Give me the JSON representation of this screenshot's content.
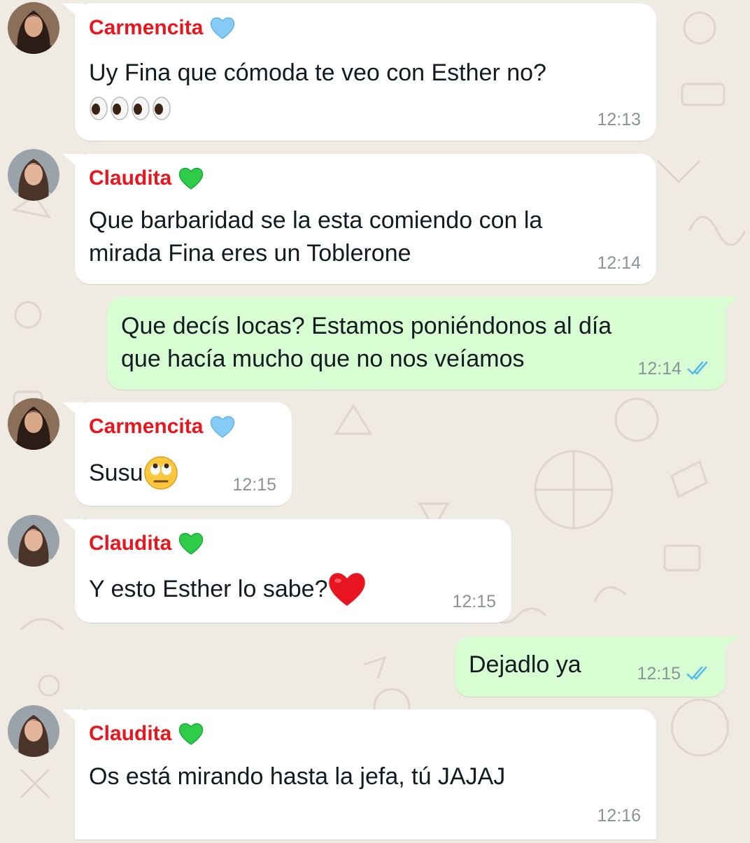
{
  "colors": {
    "background": "#efeae2",
    "incoming_bubble": "#ffffff",
    "outgoing_bubble": "#d9fdd3",
    "sender_name": "#e8171d",
    "read_ticks": "#53bdeb",
    "timestamp": "#8a9399"
  },
  "messages": [
    {
      "direction": "in",
      "sender": "Carmencita",
      "heart": "blue-heart-icon",
      "lines": [
        "Uy Fina que cómoda te veo con Esther no?"
      ],
      "emoji": "eyes-emoji x4",
      "time": "12:13"
    },
    {
      "direction": "in",
      "sender": "Claudita",
      "heart": "green-heart-icon",
      "lines": [
        "Que barbaridad se la esta comiendo con la",
        "mirada Fina eres un Toblerone"
      ],
      "time": "12:14"
    },
    {
      "direction": "out",
      "lines": [
        "Que decís locas? Estamos poniéndonos al día",
        "que hacía mucho que no nos veíamos"
      ],
      "time": "12:14",
      "status": "read"
    },
    {
      "direction": "in",
      "sender": "Carmencita",
      "heart": "blue-heart-icon",
      "lines": [
        "Susu"
      ],
      "emoji": "eye-roll-emoji",
      "time": "12:15"
    },
    {
      "direction": "in",
      "sender": "Claudita",
      "heart": "green-heart-icon",
      "lines": [
        "Y esto Esther lo sabe?"
      ],
      "emoji": "red-heart-emoji",
      "time": "12:15"
    },
    {
      "direction": "out",
      "lines": [
        "Dejadlo ya"
      ],
      "time": "12:15",
      "status": "read"
    },
    {
      "direction": "in",
      "sender": "Claudita",
      "heart": "green-heart-icon",
      "lines": [
        "Os está mirando hasta la jefa, tú JAJAJ"
      ],
      "time": "12:16"
    }
  ]
}
